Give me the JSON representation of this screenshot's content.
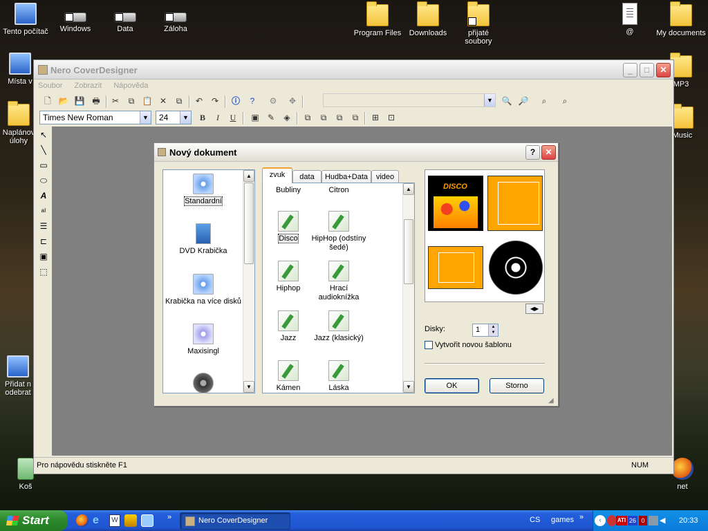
{
  "desktop": {
    "icons": [
      {
        "label": "Tento počítač",
        "kind": "pc"
      },
      {
        "label": "Windows",
        "kind": "drive"
      },
      {
        "label": "Data",
        "kind": "drive"
      },
      {
        "label": "Záloha",
        "kind": "drive"
      },
      {
        "label": "Program Files",
        "kind": "folder"
      },
      {
        "label": "Downloads",
        "kind": "folder"
      },
      {
        "label": "přijaté soubory",
        "kind": "folder"
      },
      {
        "label": "@",
        "kind": "doc"
      },
      {
        "label": "My documents",
        "kind": "folder"
      },
      {
        "label": "Místa v",
        "kind": "pc"
      },
      {
        "label": "MP3",
        "kind": "folder"
      },
      {
        "label": "Naplánov úlohy",
        "kind": "folder"
      },
      {
        "label": "Music",
        "kind": "folder"
      },
      {
        "label": "Přidat n odebrat",
        "kind": "pc"
      },
      {
        "label": "Koš",
        "kind": "bin"
      },
      {
        "label": "net",
        "kind": "firefox"
      }
    ]
  },
  "app": {
    "title": "Nero CoverDesigner",
    "menu": [
      "Soubor",
      "Zobrazit",
      "Nápověda"
    ],
    "font_name": "Times New Roman",
    "font_size": "24",
    "bold": "B",
    "italic": "I",
    "underline": "U",
    "status_left": "Pro nápovědu stiskněte F1",
    "status_right": "NUM"
  },
  "dialog": {
    "title": "Nový dokument",
    "help": "?",
    "close": "✕",
    "doc_types": [
      "Standardní",
      "DVD Krabička",
      "Krabička na více disků",
      "Maxisingl"
    ],
    "tabs": [
      "zvuk",
      "data",
      "Hudba+Data",
      "video"
    ],
    "templates": [
      {
        "label": "Bubliny"
      },
      {
        "label": "Citron"
      },
      {
        "label": "Disco"
      },
      {
        "label": "HipHop (odstíny šedé)"
      },
      {
        "label": "Hiphop"
      },
      {
        "label": "Hrací audioknížka"
      },
      {
        "label": "Jazz"
      },
      {
        "label": "Jazz (klasický)"
      },
      {
        "label": "Kámen"
      },
      {
        "label": "Láska"
      }
    ],
    "preview_title": "DISCO",
    "disks_label": "Disky:",
    "disks_value": "1",
    "new_template_label": "Vytvořit novou šablonu",
    "ok": "OK",
    "cancel": "Storno"
  },
  "taskbar": {
    "start": "Start",
    "task": "Nero CoverDesigner",
    "lang": "CS",
    "toolbar_name": "games",
    "ati": "ATI",
    "temp": "26",
    "num0": "0",
    "clock": "20:33"
  },
  "colors": {
    "accent": "#245edb",
    "cover_orange": "#ffa500",
    "selection_tab": "#f0a030"
  }
}
